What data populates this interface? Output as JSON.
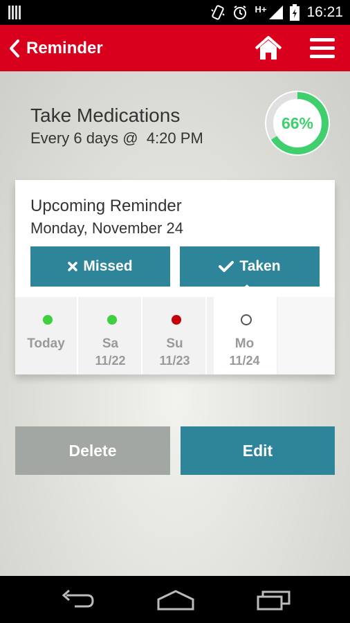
{
  "status_bar": {
    "network": "H+",
    "time": "16:21"
  },
  "app_bar": {
    "title": "Reminder",
    "back_icon": "chevron-left-icon",
    "home_icon": "home-icon",
    "menu_icon": "hamburger-menu-icon"
  },
  "medication": {
    "title": "Take Medications",
    "schedule": "Every 6 days @  4:20 PM",
    "progress_label": "66%",
    "progress_fraction": 0.66
  },
  "upcoming": {
    "title": "Upcoming Reminder",
    "date": "Monday, November 24",
    "missed_label": "Missed",
    "taken_label": "Taken"
  },
  "days": [
    {
      "name": "Today",
      "date": "",
      "status": "green"
    },
    {
      "name": "Sa",
      "date": "11/22",
      "status": "green"
    },
    {
      "name": "Su",
      "date": "11/23",
      "status": "red"
    },
    {
      "name": "Mo",
      "date": "11/24",
      "status": "empty"
    }
  ],
  "actions": {
    "delete_label": "Delete",
    "edit_label": "Edit"
  },
  "colors": {
    "app_bar": "#d8001c",
    "teal": "#2e8599",
    "progress_green": "#3fcf6d",
    "dot_green": "#3fcf3f",
    "dot_red": "#c4000a",
    "delete_gray": "#a2a7a3"
  }
}
